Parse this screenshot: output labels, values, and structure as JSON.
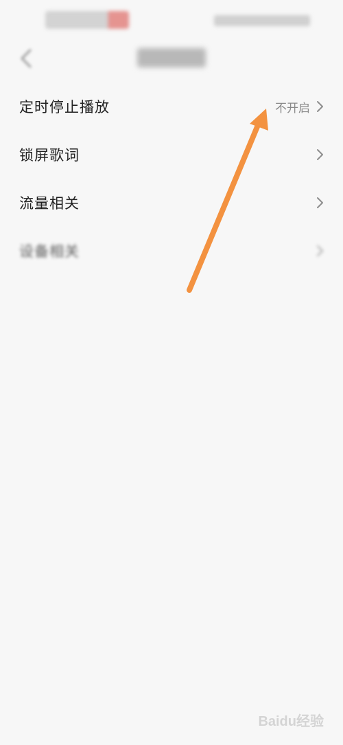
{
  "settings": {
    "items": [
      {
        "label": "定时停止播放",
        "value": "不开启"
      },
      {
        "label": "锁屏歌词",
        "value": ""
      },
      {
        "label": "流量相关",
        "value": ""
      },
      {
        "label": "设备相关",
        "value": ""
      }
    ]
  },
  "colors": {
    "background": "#f7f7f7",
    "text": "#222222",
    "secondary_text": "#8a8a8a",
    "annotation_arrow": "#f39240"
  },
  "icons": {
    "back": "back-icon",
    "chevron": "chevron-right-icon",
    "annotation": "arrow-annotation-icon"
  },
  "watermark": "Baidu经验"
}
